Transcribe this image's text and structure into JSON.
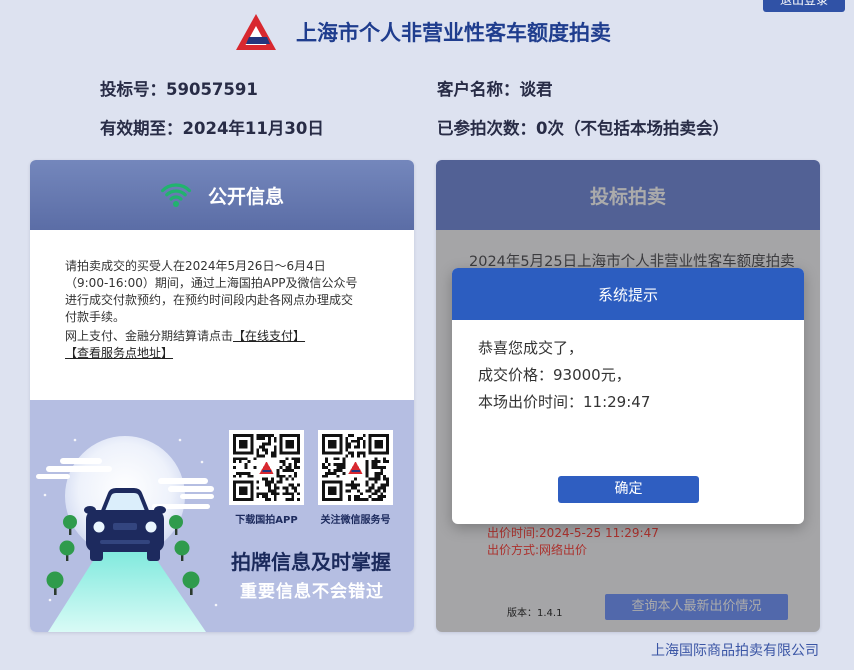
{
  "header": {
    "logout_label": "退出登录",
    "title": "上海市个人非营业性客车额度拍卖",
    "logo_icon": "auction-logo-icon"
  },
  "bidder": {
    "bid_no": {
      "label": "投标号：",
      "value": "59057591"
    },
    "customer": {
      "label": "客户名称：",
      "value": "谈君"
    },
    "valid_until": {
      "label": "有效期至：",
      "value": "2024年11月30日"
    },
    "auction_count": {
      "label": "已参拍次数：",
      "value": "0次（不包括本场拍卖会）"
    }
  },
  "public_info": {
    "title": "公开信息",
    "icon": "broadcast-icon",
    "notice_lines": [
      "请拍卖成交的买受人在2024年5月26日～6月4日",
      "（9:00-16:00）期间，通过上海国拍APP及微信公众号",
      "进行成交付款预约，在预约时间段内赴各网点办理成交",
      "付款手续。"
    ],
    "pay_prefix": "网上支付、金融分期结算请点击",
    "pay_link": "【在线支付】",
    "address_link": "【查看服务点地址】",
    "promo": {
      "qr_app_label": "下载国拍APP",
      "qr_wechat_label": "关注微信服务号",
      "headline": "拍牌信息及时掌握",
      "subline": "重要信息不会错过"
    }
  },
  "bidding": {
    "title": "投标拍卖",
    "auction_name": "2024年5月25日上海市个人非营业性客车额度拍卖",
    "bid_time": "出价时间:2024-5-25 11:29:47",
    "bid_method": "出价方式:网络出价",
    "version": "版本：1.4.1",
    "query_button": "查询本人最新出价情况"
  },
  "dialog": {
    "title": "系统提示",
    "lines": [
      "恭喜您成交了，",
      "成交价格：93000元，",
      "本场出价时间：11:29:47"
    ],
    "confirm_label": "确定"
  },
  "footer": {
    "company": "上海国际商品拍卖有限公司"
  },
  "theme": {
    "title_blue": "#1f3d8e",
    "panel_header": "#6a7cb3",
    "dialog_blue": "#2c5dc0",
    "logo_red": "#d8282f",
    "signal_green": "#21b36e",
    "bid_red": "#ff4b45"
  }
}
